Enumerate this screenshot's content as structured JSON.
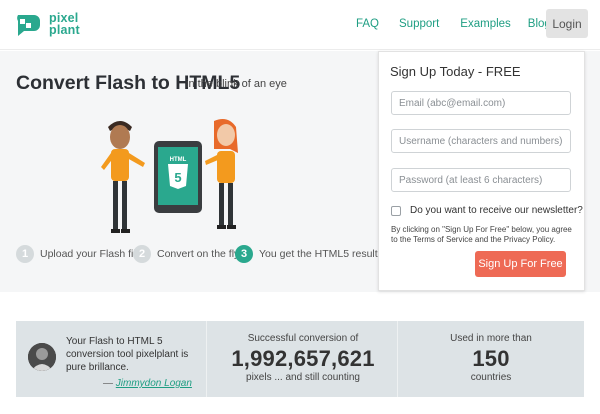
{
  "header": {
    "logo": {
      "line1": "pixel",
      "line2": "plant"
    },
    "nav": [
      {
        "label": "FAQ"
      },
      {
        "label": "Support"
      },
      {
        "label": "Examples"
      },
      {
        "label": "Blog"
      }
    ],
    "login_label": "Login"
  },
  "hero": {
    "title": "Convert Flash to HTML5",
    "subtitle": "in the blink of an eye",
    "illustration_text": "HTML",
    "badge_number": "5",
    "steps": [
      {
        "number": "1",
        "label": "Upload your Flash file",
        "active": false
      },
      {
        "number": "2",
        "label": "Convert on the fly",
        "active": false
      },
      {
        "number": "3",
        "label": "You get the HTML5 result",
        "active": true
      }
    ]
  },
  "signup": {
    "title": "Sign Up Today - FREE",
    "email_placeholder": "Email (abc@email.com)",
    "username_placeholder": "Username (characters and numbers)",
    "password_placeholder": "Password (at least 6 characters)",
    "newsletter_label": "Do you want to receive our newsletter?",
    "newsletter_checked": false,
    "terms_text": "By clicking on \"Sign Up For Free\" below, you agree to the Terms of Service and the Privacy Policy.",
    "button_label": "Sign Up For Free"
  },
  "stats": {
    "quote": "Your Flash to HTML 5 conversion tool pixelplant is pure brillance.",
    "author_prefix": "— ",
    "author": "Jimmydon Logan",
    "conversions_caption": "Successful conversion of",
    "conversions_value": "1,992,657,621",
    "conversions_sub": "pixels ... and still counting",
    "countries_caption": "Used in more than",
    "countries_value": "150",
    "countries_sub": "countries"
  },
  "colors": {
    "accent": "#2aa88e",
    "cta": "#ee6a55",
    "hero_bg": "#f5f6f7",
    "stats_bg": "#dde3e6"
  }
}
